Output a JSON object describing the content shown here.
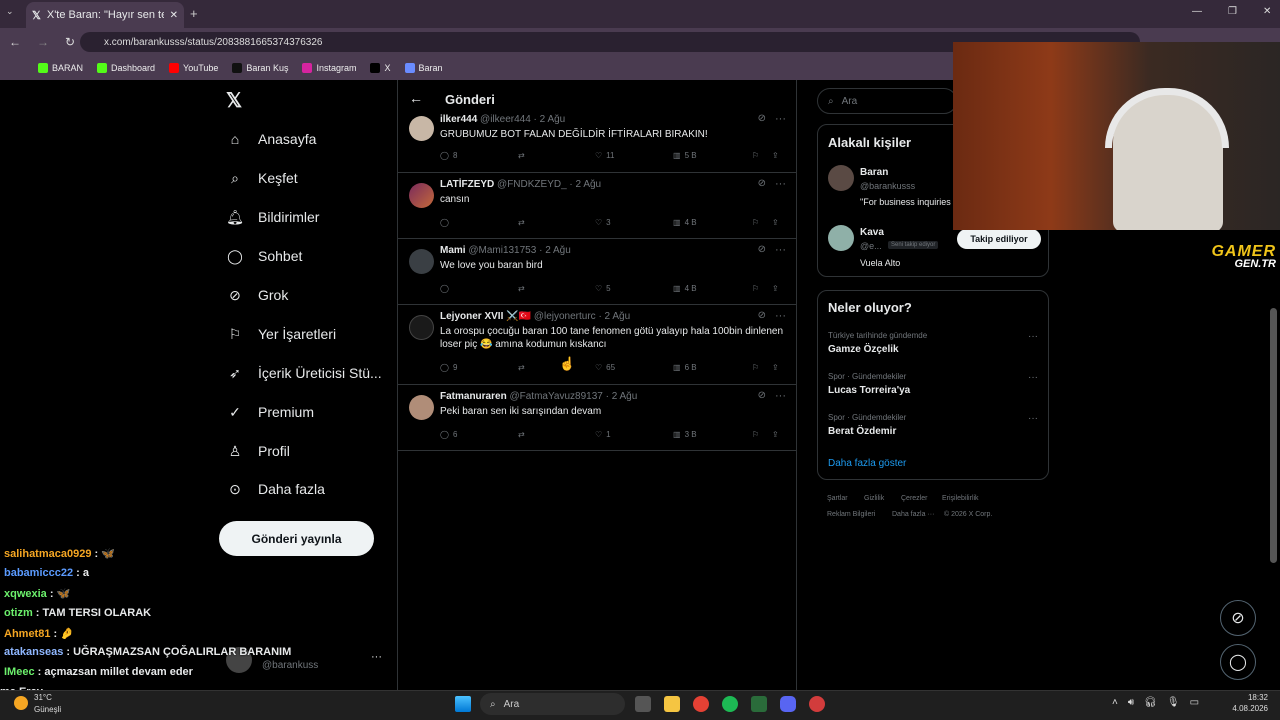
{
  "browser": {
    "tab_title": "X'te Baran: \"Hayır sen tek başına",
    "url": "x.com/barankusss/status/2083881665374376326",
    "bookmarks": [
      "BARAN",
      "Dashboard",
      "YouTube",
      "Baran Kuş",
      "Instagram",
      "X",
      "Baran"
    ]
  },
  "nav": {
    "items": [
      "Anasayfa",
      "Keşfet",
      "Bildirimler",
      "Sohbet",
      "Grok",
      "Yer İşaretleri",
      "İçerik Üreticisi Stü...",
      "Premium",
      "Profil",
      "Daha fazla"
    ],
    "post_button": "Gönderi yayınla",
    "account_handle": "@barankuss"
  },
  "main": {
    "title": "Gönderi",
    "tweets": [
      {
        "name": "ilker444",
        "handle": "@ilkeer444 · 2 Ağu",
        "text": "GRUBUMUZ BOT FALAN DEĞİLDİR İFTİRALARI BIRAKIN!",
        "replies": "8",
        "likes": "11",
        "views": "5 B"
      },
      {
        "name": "LATİFZEYD",
        "handle": "@FNDKZEYD_ · 2 Ağu",
        "text": "cansın",
        "replies": "",
        "likes": "3",
        "views": "4 B"
      },
      {
        "name": "Mami",
        "handle": "@Mami131753 · 2 Ağu",
        "text": "We love you baran bird",
        "replies": "",
        "likes": "5",
        "views": "4 B"
      },
      {
        "name": "Lejyoner XVII ⚔️🇹🇷",
        "handle": "@lejyonerturc · 2 Ağu",
        "text": "La orospu çocuğu baran 100 tane fenomen götü yalayıp hala 100bin dinlenen loser piç 😂 amına kodumun kıskancı",
        "replies": "9",
        "likes": "65",
        "views": "6 B"
      },
      {
        "name": "Fatmanuraren",
        "handle": "@FatmaYavuz89137 · 2 Ağu",
        "text": "Peki baran sen iki sarışından devam",
        "replies": "6",
        "likes": "1",
        "views": "3 B"
      }
    ]
  },
  "right": {
    "search_placeholder": "Ara",
    "relevant_title": "Alakalı kişiler",
    "people": [
      {
        "name": "Baran",
        "handle": "@barankusss",
        "bio": "\"For business inquiries"
      },
      {
        "name": "Kava",
        "handle": "@e...",
        "follows_you": "Seni takip ediyor",
        "bio": "Vuela Alto",
        "button": "Takip ediliyor"
      }
    ],
    "trends_title": "Neler oluyor?",
    "trends": [
      {
        "category": "Türkiye tarihinde gündemde",
        "name": "Gamze Özçelik"
      },
      {
        "category": "Spor · Gündemdekiler",
        "name": "Lucas Torreira'ya"
      },
      {
        "category": "Spor · Gündemdekiler",
        "name": "Berat Özdemir"
      }
    ],
    "show_more": "Daha fazla göster",
    "footer": [
      "Şartlar",
      "Gizlilik",
      "Çerezler",
      "Erişilebilirlik",
      "Reklam Bilgileri",
      "Daha fazla ···",
      "© 2026 X Corp."
    ]
  },
  "overlay": {
    "logo_line1": "GAMER",
    "logo_line2": "GEN.TR",
    "chat": [
      {
        "user": "salihatmaca0929",
        "msg": ": 🦋",
        "color": "#f5a623"
      },
      {
        "user": "babamiccc22",
        "msg": ": a",
        "color": "#5b9bff"
      },
      {
        "user": "xqwexia",
        "msg": ": 🦋",
        "color": "#6cf06c"
      },
      {
        "user": "otizm",
        "msg": ": TAM TERSI OLARAK",
        "color": "#6cf06c"
      },
      {
        "user": "Ahmet81",
        "msg": ": 🤌",
        "color": "#f5a623"
      },
      {
        "user": "atakanseas",
        "msg": ": UĞRAŞMAZSAN ÇOĞALIRLAR BARANIM",
        "color": "#8fb7ff"
      },
      {
        "user": "IMeec",
        "msg": ": açmazsan millet devam eder",
        "color": "#6cf06c"
      },
      {
        "user": "",
        "msg": "ma Eray",
        "color": "#ffffff"
      }
    ]
  },
  "taskbar": {
    "weather_temp": "31°C",
    "weather_text": "Güneşli",
    "search": "Ara",
    "time": "18:32",
    "date": "4.08.2026"
  }
}
